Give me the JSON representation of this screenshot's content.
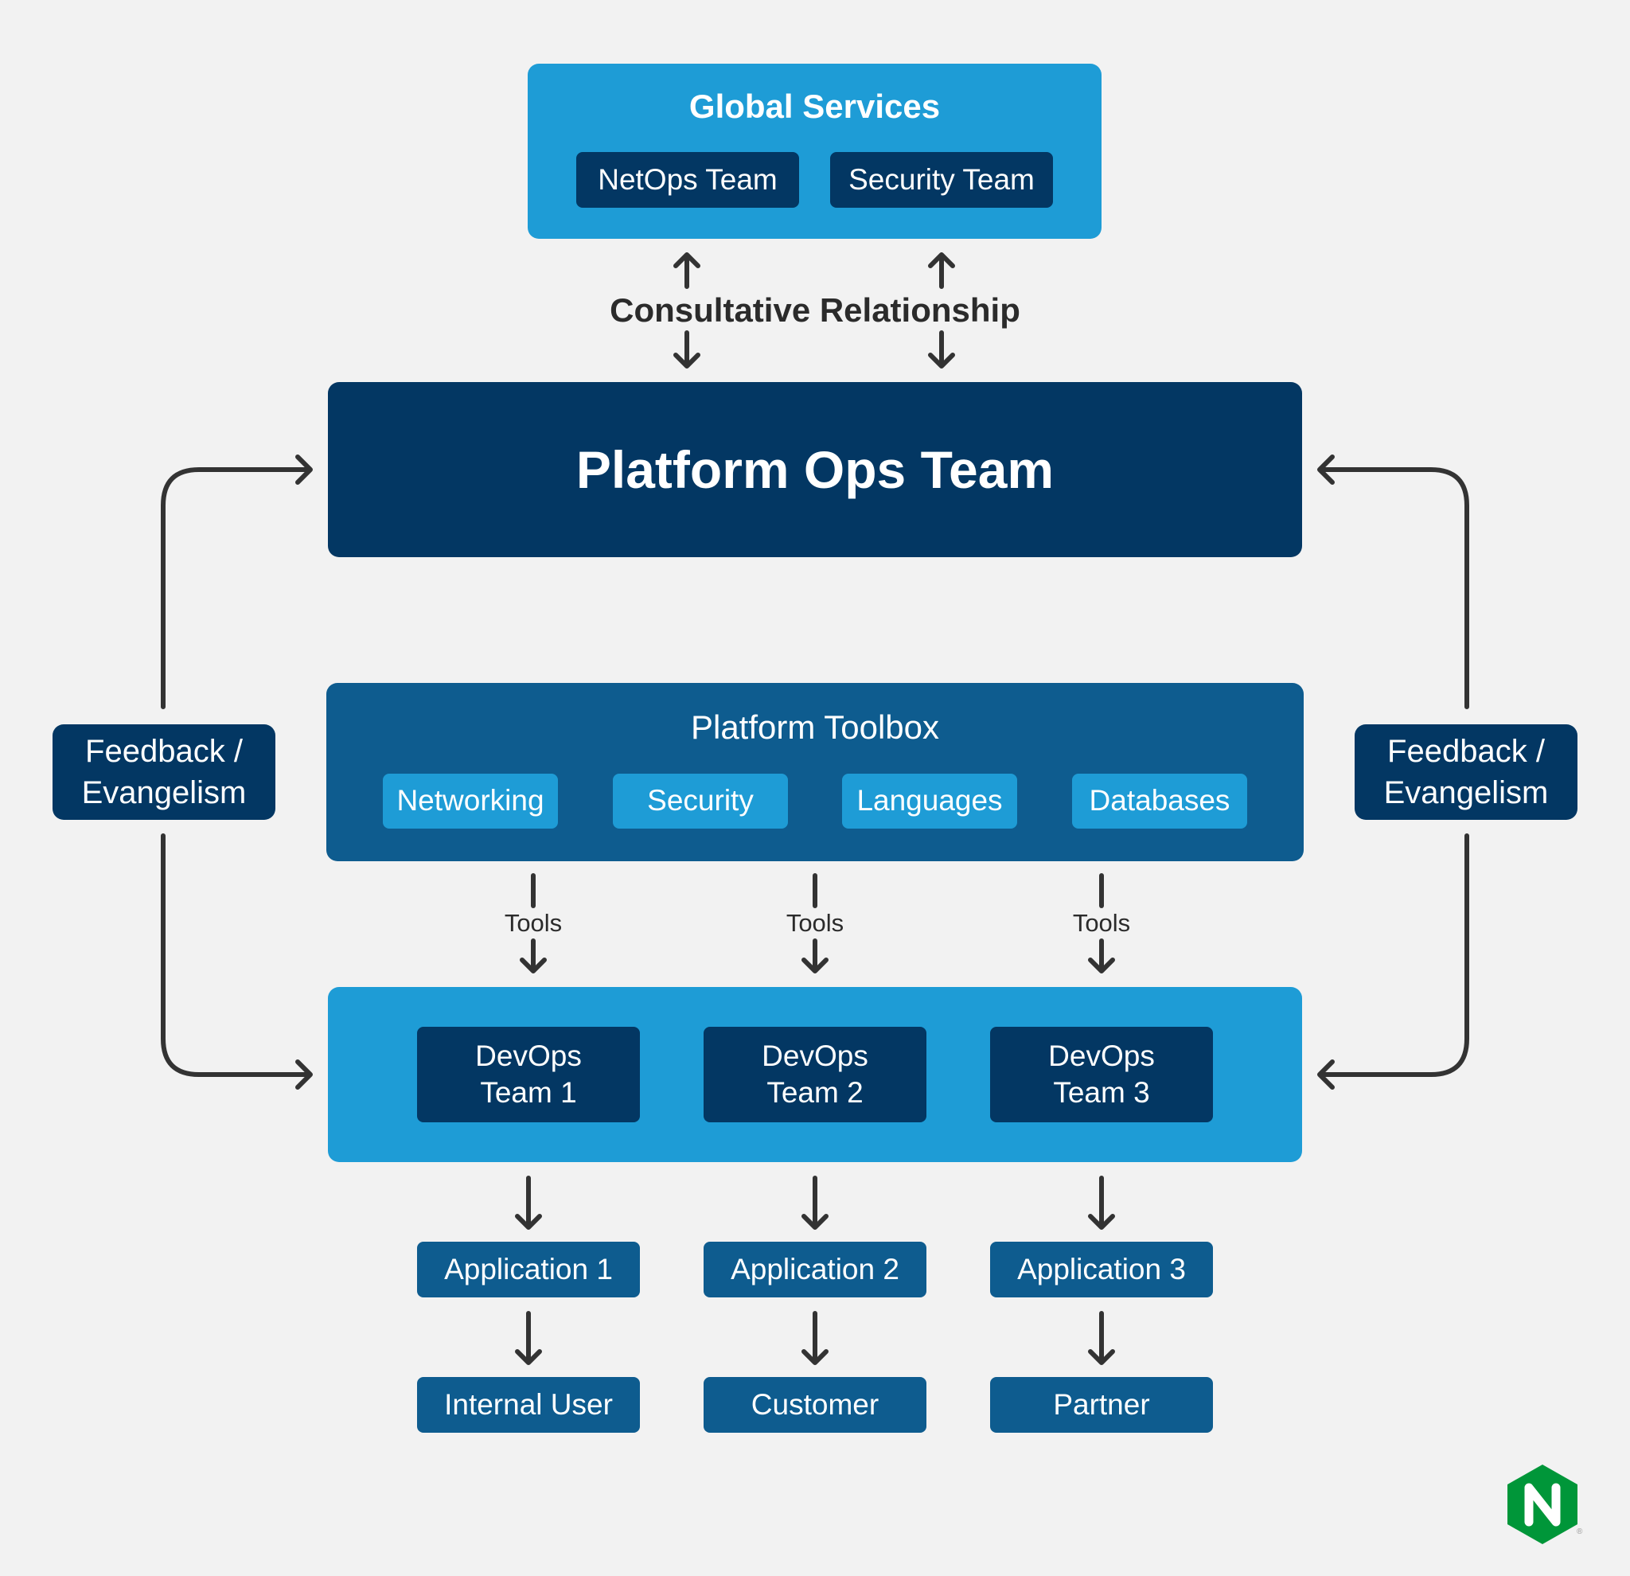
{
  "global_services": {
    "title": "Global Services",
    "teams": [
      "NetOps Team",
      "Security Team"
    ]
  },
  "consultative_label": "Consultative Relationship",
  "platform_ops": {
    "title": "Platform Ops Team"
  },
  "toolbox": {
    "title": "Platform Toolbox",
    "items": [
      "Networking",
      "Security",
      "Languages",
      "Databases"
    ]
  },
  "tools_label": "Tools",
  "feedback": {
    "left_line1": "Feedback /",
    "left_line2": "Evangelism",
    "right_line1": "Feedback /",
    "right_line2": "Evangelism"
  },
  "devops": {
    "teams": [
      {
        "line1": "DevOps",
        "line2": "Team 1"
      },
      {
        "line1": "DevOps",
        "line2": "Team 2"
      },
      {
        "line1": "DevOps",
        "line2": "Team 3"
      }
    ]
  },
  "applications": [
    "Application 1",
    "Application 2",
    "Application 3"
  ],
  "consumers": [
    "Internal User",
    "Customer",
    "Partner"
  ],
  "logo": {
    "letter": "N",
    "registered": "®",
    "color": "#009639"
  },
  "colors": {
    "light_blue": "#1e9cd6",
    "navy": "#033763",
    "mid_blue": "#0e5c8f",
    "arrow": "#333333",
    "background": "#f2f2f2"
  }
}
